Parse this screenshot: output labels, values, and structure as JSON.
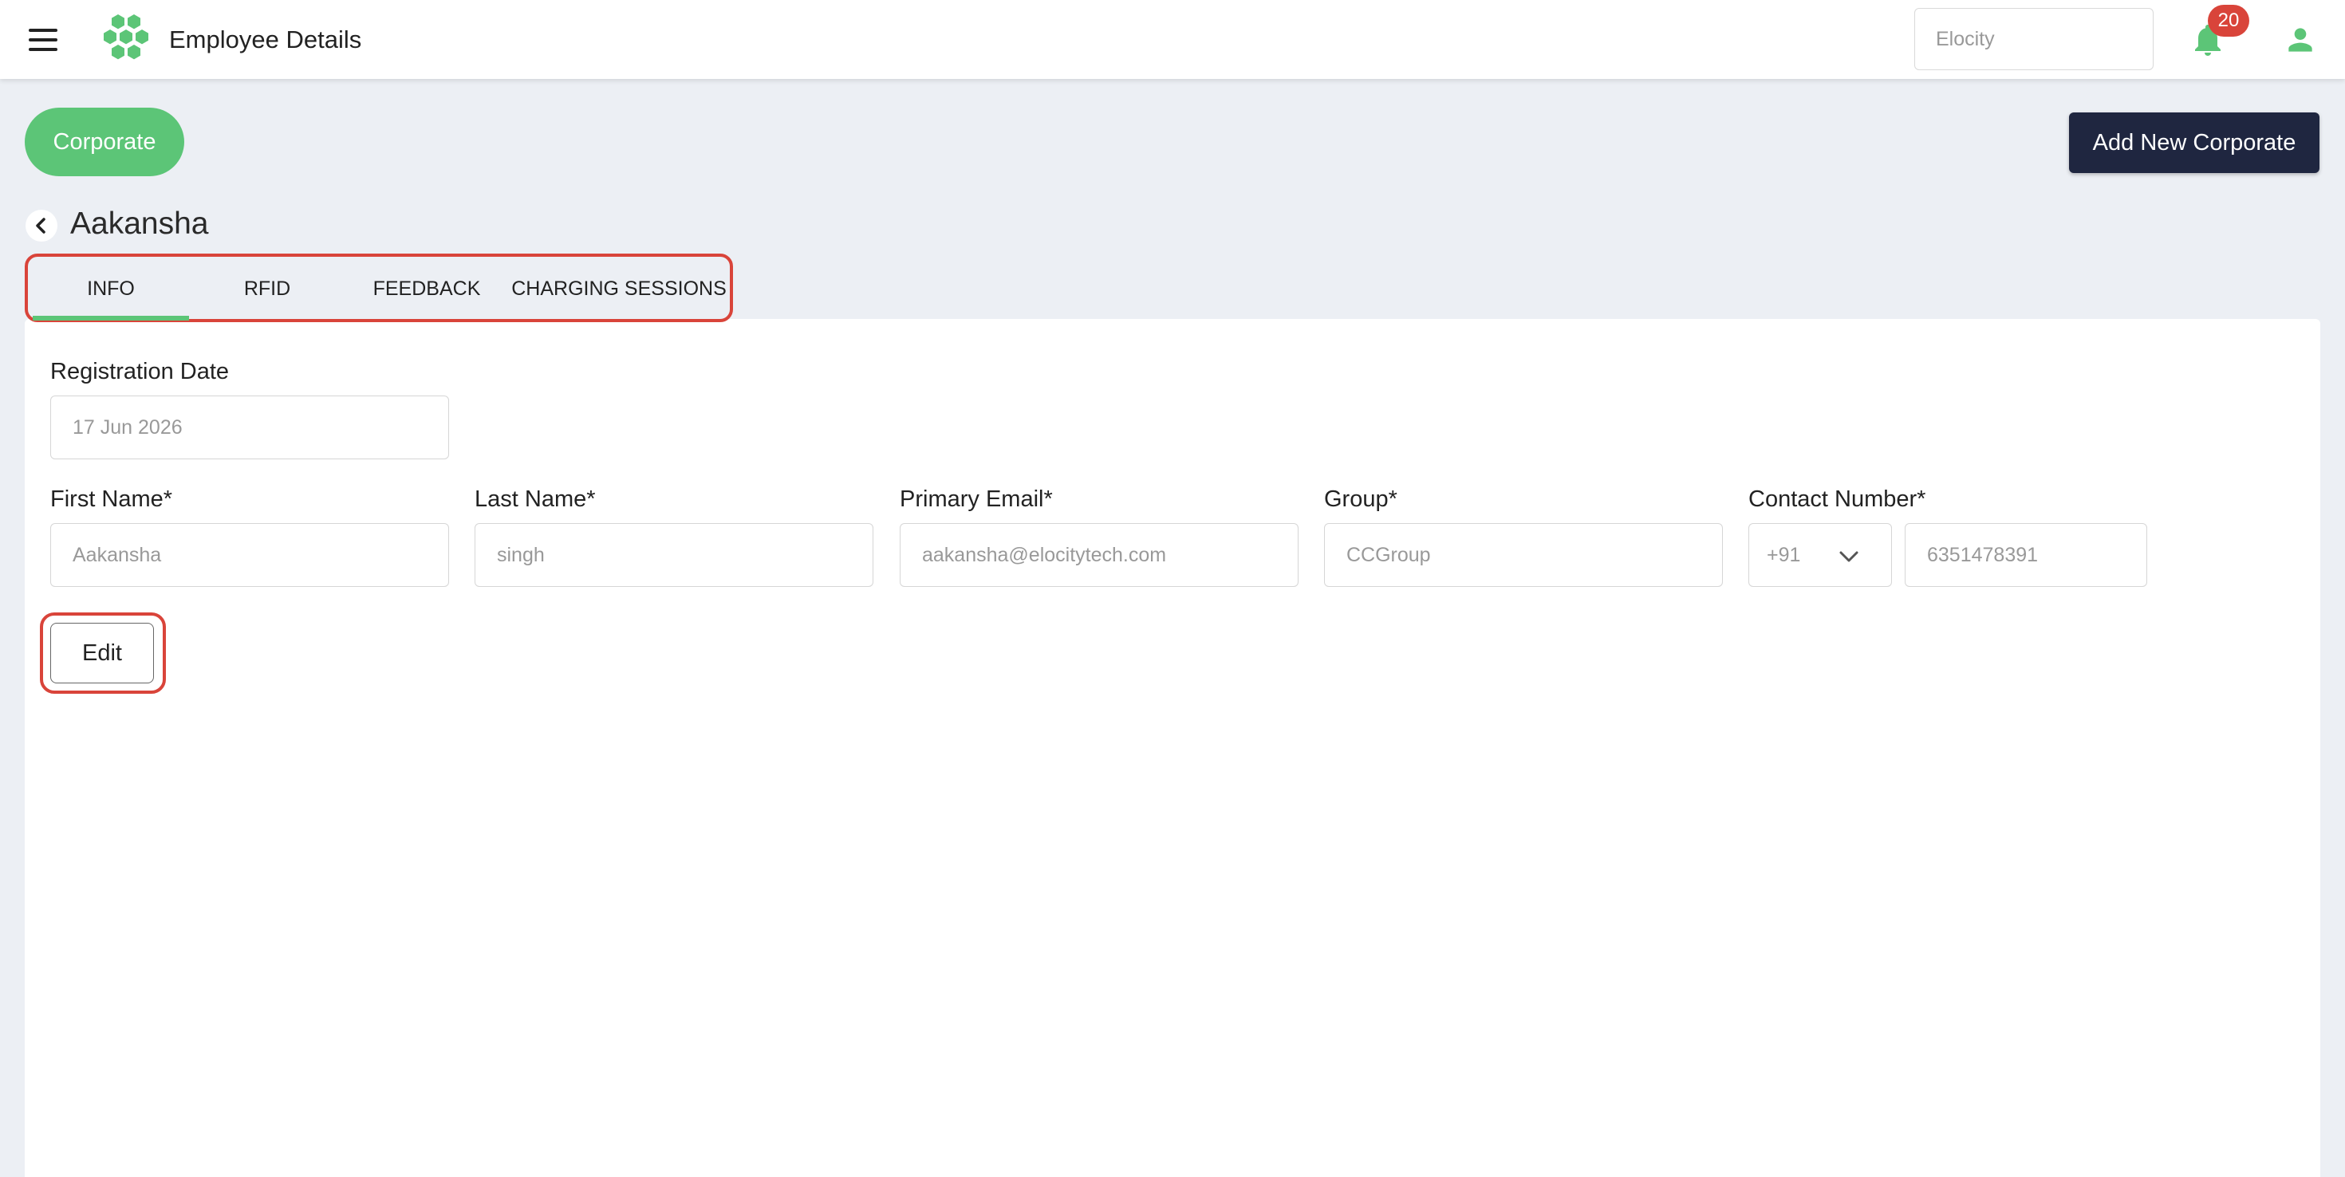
{
  "header": {
    "title": "Employee Details",
    "brand_select_value": "Elocity",
    "notification_count": "20",
    "accent_color": "#5cc577",
    "badge_color": "#d9443a"
  },
  "toolbar": {
    "corporate_label": "Corporate",
    "add_new_label": "Add New Corporate"
  },
  "page": {
    "person_name": "Aakansha"
  },
  "tabs": [
    {
      "label": "INFO",
      "active": true
    },
    {
      "label": "RFID",
      "active": false
    },
    {
      "label": "FEEDBACK",
      "active": false
    },
    {
      "label": "CHARGING SESSIONS",
      "active": false
    }
  ],
  "form": {
    "registration_date": {
      "label": "Registration Date",
      "value": "17 Jun 2026"
    },
    "first_name": {
      "label": "First Name*",
      "value": "Aakansha"
    },
    "last_name": {
      "label": "Last Name*",
      "value": "singh"
    },
    "primary_email": {
      "label": "Primary Email*",
      "value": "aakansha@elocitytech.com"
    },
    "group": {
      "label": "Group*",
      "value": "CCGroup"
    },
    "contact_number": {
      "label": "Contact Number*",
      "country_code": "+91",
      "value": "6351478391"
    },
    "edit_label": "Edit"
  },
  "icons": {
    "menu": "hamburger-menu-icon",
    "logo": "hexagon-cluster-logo",
    "bell": "bell-icon",
    "user": "user-icon",
    "back": "chevron-left-icon",
    "dropdown": "chevron-down-icon"
  }
}
